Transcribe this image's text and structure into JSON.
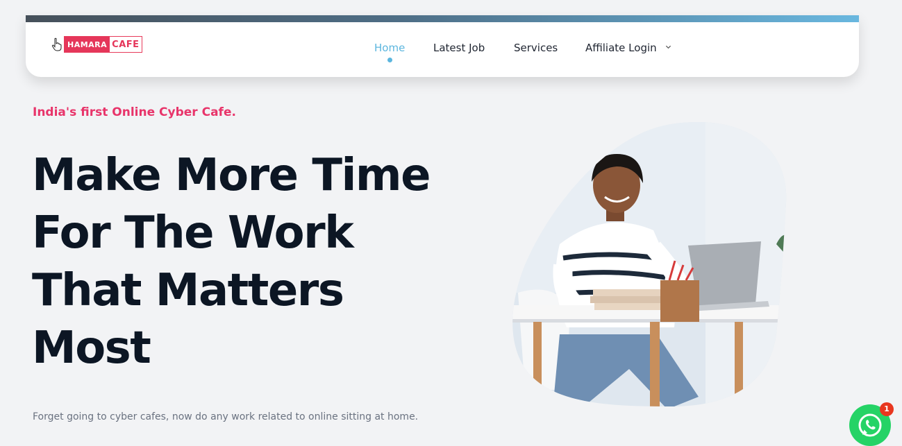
{
  "header": {
    "logo": {
      "part1": "HAMARA",
      "part2": "CAFE"
    },
    "nav": [
      {
        "label": "Home",
        "active": true
      },
      {
        "label": "Latest Job",
        "active": false
      },
      {
        "label": "Services",
        "active": false
      },
      {
        "label": "Affiliate Login",
        "active": false,
        "has_dropdown": true
      }
    ]
  },
  "hero": {
    "tagline": "India's first Online Cyber Cafe.",
    "headline_lines": [
      "Make More Time",
      "For The Work",
      "That Matters",
      "Most"
    ],
    "subtext": "Forget going to cyber cafes, now do any work related to online sitting at home."
  },
  "whatsapp": {
    "badge_count": "1",
    "icon": "whatsapp-icon"
  },
  "colors": {
    "accent_pink": "#e8346a",
    "nav_active": "#5cb6de",
    "heading": "#0c1624",
    "whatsapp_green": "#25d366"
  }
}
